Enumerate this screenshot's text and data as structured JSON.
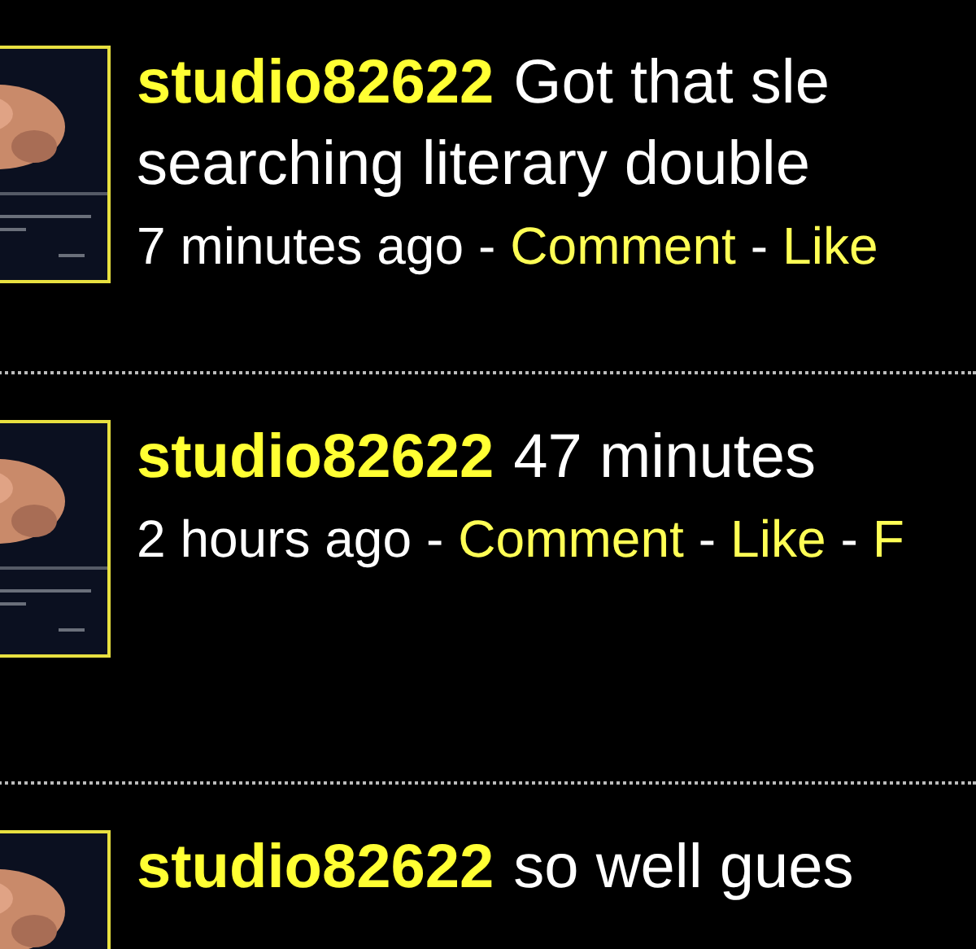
{
  "posts": [
    {
      "thumbnail": {
        "kind": "picture"
      },
      "username": "studio82622",
      "text": [
        "Got that sle",
        "searching literary double"
      ],
      "time": "7 minutes ago",
      "separator": "-",
      "actions": [
        "Comment",
        "Like"
      ]
    },
    {
      "thumbnail": {
        "kind": "picture"
      },
      "username": "studio82622",
      "text": [
        "47 minutes"
      ],
      "time": "2 hours ago",
      "separator": "-",
      "actions": [
        "Comment",
        "Like",
        "F"
      ]
    },
    {
      "thumbnail": {
        "kind": "picture"
      },
      "username": "studio82622",
      "text": [
        "so well gues"
      ]
    }
  ]
}
